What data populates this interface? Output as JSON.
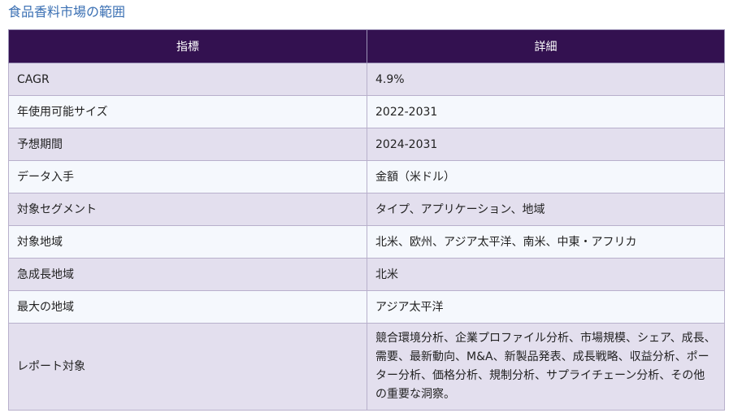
{
  "page": {
    "title": "食品香料市場の範囲"
  },
  "table": {
    "headers": [
      "指標",
      "詳細"
    ],
    "rows": [
      {
        "label": "CAGR",
        "value": "4.9%"
      },
      {
        "label": "年使用可能サイズ",
        "value": "2022-2031"
      },
      {
        "label": "予想期間",
        "value": "2024-2031"
      },
      {
        "label": "データ入手",
        "value": "金額（米ドル）"
      },
      {
        "label": "対象セグメント",
        "value": "タイプ、アプリケーション、地域"
      },
      {
        "label": "対象地域",
        "value": "北米、欧州、アジア太平洋、南米、中東・アフリカ"
      },
      {
        "label": "急成長地域",
        "value": "北米"
      },
      {
        "label": "最大の地域",
        "value": "アジア太平洋"
      },
      {
        "label": "レポート対象",
        "value": "競合環境分析、企業プロファイル分析、市場規模、シェア、成長、需要、最新動向、M&A、新製品発表、成長戦略、収益分析、ポーター分析、価格分析、規制分析、サプライチェーン分析、その他の重要な洞察。"
      }
    ]
  },
  "colors": {
    "title": "#3a6fb3",
    "header_bg": "#331150",
    "header_text": "#ffffff",
    "row_odd": "#e3dfee",
    "row_even": "#f5f8fd"
  }
}
